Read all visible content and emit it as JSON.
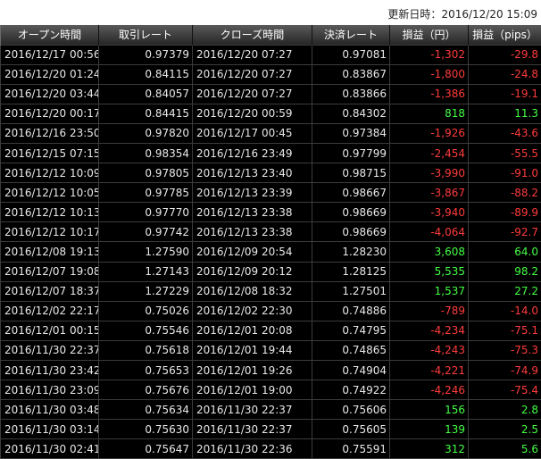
{
  "header": {
    "updated_label": "更新日時：",
    "updated_value": "2016/12/20 15:09"
  },
  "table": {
    "columns": [
      "オープン時間",
      "取引レート",
      "クローズ時間",
      "決済レート",
      "損益（円）",
      "損益（pips）"
    ],
    "rows": [
      {
        "open_time": "2016/12/17 00:56",
        "open_rate": "0.97379",
        "close_time": "2016/12/20 07:27",
        "close_rate": "0.97081",
        "pnl_yen": "-1,302",
        "pnl_pips": "-29.8"
      },
      {
        "open_time": "2016/12/20 01:24",
        "open_rate": "0.84115",
        "close_time": "2016/12/20 07:27",
        "close_rate": "0.83867",
        "pnl_yen": "-1,800",
        "pnl_pips": "-24.8"
      },
      {
        "open_time": "2016/12/20 03:44",
        "open_rate": "0.84057",
        "close_time": "2016/12/20 07:27",
        "close_rate": "0.83866",
        "pnl_yen": "-1,386",
        "pnl_pips": "-19.1"
      },
      {
        "open_time": "2016/12/20 00:17",
        "open_rate": "0.84415",
        "close_time": "2016/12/20 00:59",
        "close_rate": "0.84302",
        "pnl_yen": "818",
        "pnl_pips": "11.3"
      },
      {
        "open_time": "2016/12/16 23:50",
        "open_rate": "0.97820",
        "close_time": "2016/12/17 00:45",
        "close_rate": "0.97384",
        "pnl_yen": "-1,926",
        "pnl_pips": "-43.6"
      },
      {
        "open_time": "2016/12/15 07:15",
        "open_rate": "0.98354",
        "close_time": "2016/12/16 23:49",
        "close_rate": "0.97799",
        "pnl_yen": "-2,454",
        "pnl_pips": "-55.5"
      },
      {
        "open_time": "2016/12/12 10:09",
        "open_rate": "0.97805",
        "close_time": "2016/12/13 23:40",
        "close_rate": "0.98715",
        "pnl_yen": "-3,990",
        "pnl_pips": "-91.0"
      },
      {
        "open_time": "2016/12/12 10:05",
        "open_rate": "0.97785",
        "close_time": "2016/12/13 23:39",
        "close_rate": "0.98667",
        "pnl_yen": "-3,867",
        "pnl_pips": "-88.2"
      },
      {
        "open_time": "2016/12/12 10:13",
        "open_rate": "0.97770",
        "close_time": "2016/12/13 23:38",
        "close_rate": "0.98669",
        "pnl_yen": "-3,940",
        "pnl_pips": "-89.9"
      },
      {
        "open_time": "2016/12/12 10:17",
        "open_rate": "0.97742",
        "close_time": "2016/12/13 23:38",
        "close_rate": "0.98669",
        "pnl_yen": "-4,064",
        "pnl_pips": "-92.7"
      },
      {
        "open_time": "2016/12/08 19:13",
        "open_rate": "1.27590",
        "close_time": "2016/12/09 20:54",
        "close_rate": "1.28230",
        "pnl_yen": "3,608",
        "pnl_pips": "64.0"
      },
      {
        "open_time": "2016/12/07 19:08",
        "open_rate": "1.27143",
        "close_time": "2016/12/09 20:12",
        "close_rate": "1.28125",
        "pnl_yen": "5,535",
        "pnl_pips": "98.2"
      },
      {
        "open_time": "2016/12/07 18:37",
        "open_rate": "1.27229",
        "close_time": "2016/12/08 18:32",
        "close_rate": "1.27501",
        "pnl_yen": "1,537",
        "pnl_pips": "27.2"
      },
      {
        "open_time": "2016/12/02 22:17",
        "open_rate": "0.75026",
        "close_time": "2016/12/02 22:30",
        "close_rate": "0.74886",
        "pnl_yen": "-789",
        "pnl_pips": "-14.0"
      },
      {
        "open_time": "2016/12/01 00:15",
        "open_rate": "0.75546",
        "close_time": "2016/12/01 20:08",
        "close_rate": "0.74795",
        "pnl_yen": "-4,234",
        "pnl_pips": "-75.1"
      },
      {
        "open_time": "2016/11/30 22:37",
        "open_rate": "0.75618",
        "close_time": "2016/12/01 19:44",
        "close_rate": "0.74865",
        "pnl_yen": "-4,243",
        "pnl_pips": "-75.3"
      },
      {
        "open_time": "2016/11/30 23:42",
        "open_rate": "0.75653",
        "close_time": "2016/12/01 19:26",
        "close_rate": "0.74904",
        "pnl_yen": "-4,221",
        "pnl_pips": "-74.9"
      },
      {
        "open_time": "2016/11/30 23:09",
        "open_rate": "0.75676",
        "close_time": "2016/12/01 19:00",
        "close_rate": "0.74922",
        "pnl_yen": "-4,246",
        "pnl_pips": "-75.4"
      },
      {
        "open_time": "2016/11/30 03:48",
        "open_rate": "0.75634",
        "close_time": "2016/11/30 22:37",
        "close_rate": "0.75606",
        "pnl_yen": "156",
        "pnl_pips": "2.8"
      },
      {
        "open_time": "2016/11/30 03:14",
        "open_rate": "0.75630",
        "close_time": "2016/11/30 22:37",
        "close_rate": "0.75605",
        "pnl_yen": "139",
        "pnl_pips": "2.5"
      },
      {
        "open_time": "2016/11/30 02:41",
        "open_rate": "0.75647",
        "close_time": "2016/11/30 22:36",
        "close_rate": "0.75591",
        "pnl_yen": "312",
        "pnl_pips": "5.6"
      }
    ]
  },
  "colors": {
    "profit": "#44ff44",
    "loss": "#ff3b3b",
    "cell_text": "#e8e8e8",
    "cell_bg": "#000000"
  }
}
